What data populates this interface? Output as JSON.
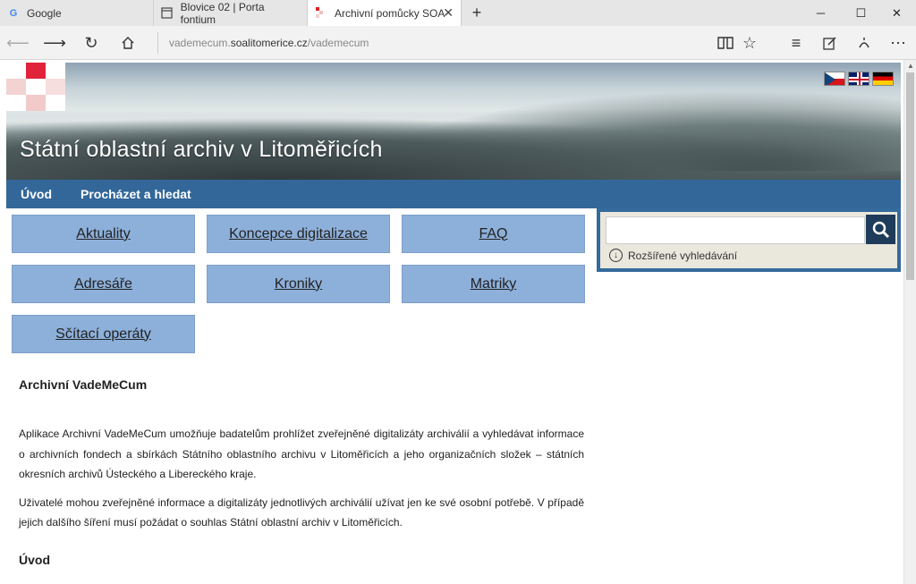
{
  "browser": {
    "tabs": [
      {
        "title": "Google",
        "favicon": "google-icon"
      },
      {
        "title": "Blovice 02 | Porta fontium",
        "favicon": "page-icon"
      },
      {
        "title": "Archivní pomůcky SOA",
        "favicon": "soa-icon",
        "active": true
      }
    ],
    "new_tab_label": "+",
    "address": {
      "prefix": "vademecum.",
      "domain": "soalitomerice.cz",
      "path": "/vademecum"
    },
    "window_controls": [
      "minimize-icon",
      "maximize-icon",
      "close-icon"
    ]
  },
  "site": {
    "title": "Státní oblastní archiv v Litoměřicích",
    "flags": [
      "cz",
      "gb",
      "de"
    ],
    "accent_color": "#336799",
    "tile_color": "#8db0da"
  },
  "nav": {
    "items": [
      "Úvod",
      "Procházet a hledat"
    ]
  },
  "tiles": [
    "Aktuality",
    "Koncepce digitalizace",
    "FAQ",
    "Adresáře",
    "Kroniky",
    "Matriky",
    "Sčítací operáty"
  ],
  "search": {
    "value": "",
    "advanced_label": "Rozšířené vyhledávání"
  },
  "content": {
    "heading": "Archivní VadeMeCum",
    "paragraph1": "Aplikace Archivní VadeMeCum umožňuje badatelům prohlížet zveřejněné digitalizáty archiválií a vyhledávat informace o archivních fondech a sbírkách Státního oblastního archivu v Litoměřicích a jeho organizačních složek – státních okresních archivů Ústeckého a Libereckého kraje.",
    "paragraph2": "Uživatelé mohou zveřejněné informace a digitalizáty jednotlivých archiválií užívat jen ke své osobní potřebě. V případě jejich dalšího šíření musí požádat o souhlas Státní oblastní archiv v Litoměřicích.",
    "subheading": "Úvod"
  }
}
